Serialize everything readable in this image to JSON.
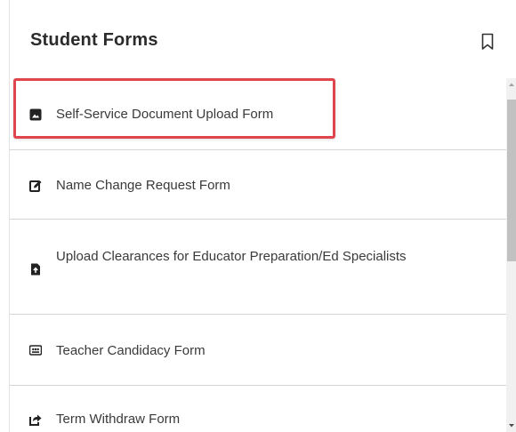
{
  "header": {
    "title": "Student Forms",
    "icon": "bookmark-icon"
  },
  "forms": [
    {
      "label": "Self-Service Document Upload Form",
      "icon": "photo-square-icon"
    },
    {
      "label": "Name Change Request Form",
      "icon": "edit-icon"
    },
    {
      "label": "Upload Clearances for Educator Preparation/Ed Specialists",
      "icon": "file-upload-icon"
    },
    {
      "label": "Teacher Candidacy Form",
      "icon": "id-card-icon"
    },
    {
      "label": "Term Withdraw Form",
      "icon": "share-arrow-icon"
    }
  ],
  "highlight": {
    "target": "Self-Service Document Upload Form",
    "color": "#e0454b"
  },
  "colors": {
    "divider": "#d6d6d6",
    "text": "#3a3a3a",
    "title": "#2b2b2b"
  }
}
